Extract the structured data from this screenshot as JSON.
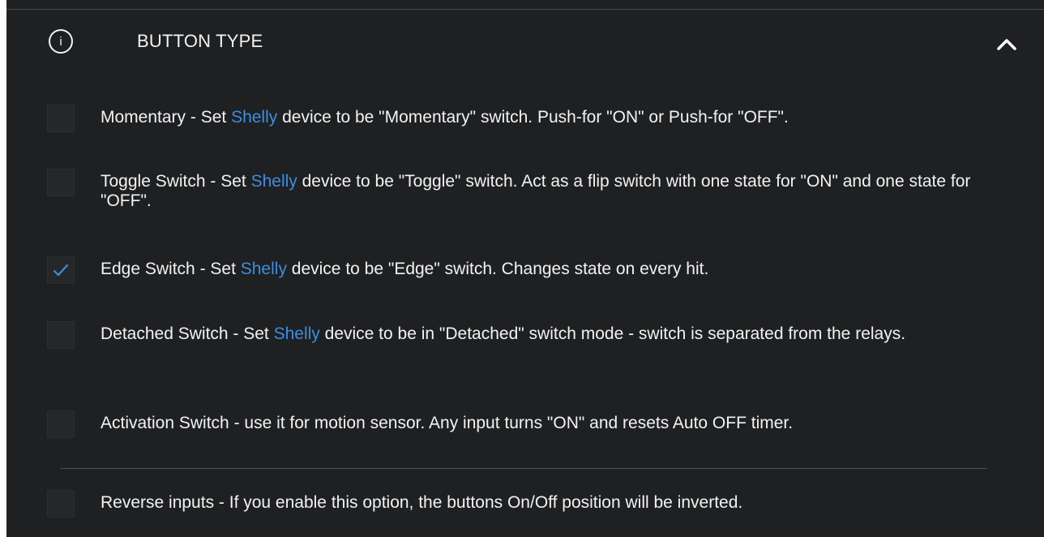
{
  "section": {
    "title": "BUTTON TYPE",
    "info_icon": "i"
  },
  "brand_link": "Shelly",
  "options": [
    {
      "pre": "Momentary - Set ",
      "post": " device to be \"Momentary\" switch. Push-for \"ON\" or Push-for \"OFF\".",
      "checked": false
    },
    {
      "pre": "Toggle Switch - Set ",
      "post": " device to be \"Toggle\" switch. Act as a flip switch with one state for \"ON\" and one state for \"OFF\".",
      "checked": false
    },
    {
      "pre": "Edge Switch - Set ",
      "post": " device to be \"Edge\" switch. Changes state on every hit.",
      "checked": true
    },
    {
      "pre": "Detached Switch - Set ",
      "post": " device to be in \"Detached\" switch mode - switch is separated from the relays.",
      "checked": false
    },
    {
      "text": "Activation Switch - use it for motion sensor. Any input turns \"ON\" and resets Auto OFF timer.",
      "checked": false
    },
    {
      "text": "Reverse inputs - If you enable this option, the buttons On/Off position will be inverted.",
      "checked": false
    }
  ],
  "colors": {
    "background": "#1f2022",
    "link": "#3b8fe0",
    "check": "#3b8fe0"
  }
}
